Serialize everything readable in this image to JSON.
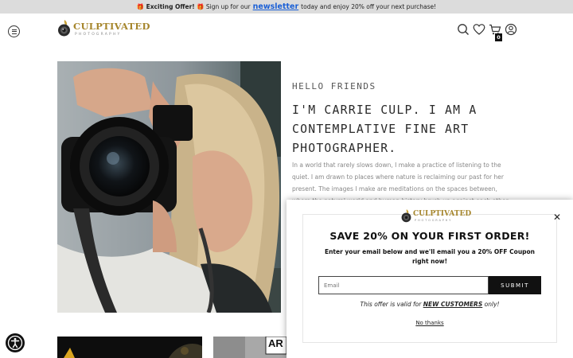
{
  "announcement": {
    "icon_left": "🎁",
    "offer": "Exciting Offer!",
    "icon_right": "🎁",
    "before": "Sign up for our",
    "link": "newsletter",
    "after": "today and enjoy 20% off your next purchase!"
  },
  "header": {
    "logo_title": "CULPTIVATED",
    "logo_subtitle": "PHOTOGRAPHY",
    "cart_count": "0"
  },
  "hero": {
    "greeting": "HELLO FRIENDS",
    "headline": "I'M CARRIE CULP. I AM A CONTEMPLATIVE FINE ART PHOTOGRAPHER.",
    "body": "In a world that rarely slows down, I make a practice of listening to the quiet. I am drawn to places where nature is reclaiming our past for her present. The images I make are meditations on the spaces between, where the natural world and human history brush up against each other."
  },
  "popup": {
    "logo_title": "CULPTIVATED",
    "logo_subtitle": "PHOTOGRAPHY",
    "title": "SAVE 20% ON YOUR FIRST ORDER!",
    "subtitle": "Enter your email below and we'll email you a 20% OFF Coupon right now!",
    "email_placeholder": "Email",
    "submit_label": "SUBMIT",
    "note_before": "This offer is valid for",
    "note_emphasis": "NEW CUSTOMERS",
    "note_after": "only!",
    "no_thanks": "No thanks"
  },
  "thumbnail_badge": "AR",
  "colors": {
    "brand_gold": "#a6862c",
    "announcement_bg": "#dcdcdc",
    "link_blue": "#1a5fd6",
    "button_black": "#111111"
  },
  "icons": [
    "menu-icon",
    "search-icon",
    "heart-icon",
    "cart-icon",
    "account-icon",
    "close-icon",
    "accessibility-icon"
  ]
}
